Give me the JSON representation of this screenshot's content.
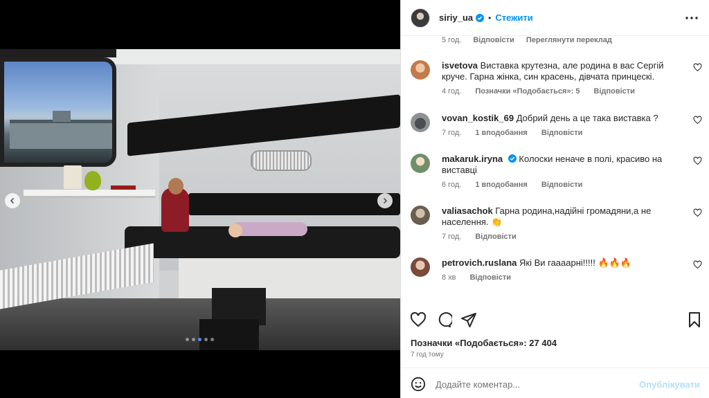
{
  "post": {
    "username": "siriy_ua",
    "separator": "•",
    "follow_label": "Стежити"
  },
  "caption_meta": {
    "time": "5 год.",
    "reply": "Відповісти",
    "translate": "Переглянути переклад"
  },
  "comments": [
    {
      "username": "isvetova",
      "text": "Виставка крутезна, але родина в вас Сергій круче. Гарна жінка, син красень, дівчата принцескі.",
      "time": "4 год.",
      "likes": "Позначки «Подобається»: 5",
      "reply": "Відповісти",
      "verified": false
    },
    {
      "username": "vovan_kostik_69",
      "text": "Добрий день а це така виставка ?",
      "time": "7 год.",
      "likes": "1 вподобання",
      "reply": "Відповісти",
      "verified": false
    },
    {
      "username": "makaruk.iryna",
      "text": "Колоски неначе в полі, красиво на виставці",
      "time": "6 год.",
      "likes": "1 вподобання",
      "reply": "Відповісти",
      "verified": true
    },
    {
      "username": "valiasachok",
      "text": "Гарна родина,надійні громадяни,а не населення. 👏",
      "time": "7 год.",
      "likes": "",
      "reply": "Відповісти",
      "verified": false
    },
    {
      "username": "petrovich.ruslana",
      "text": "Які Ви гаааарні!!!!! 🔥🔥🔥",
      "time": "8 хв",
      "likes": "",
      "reply": "Відповісти",
      "verified": false
    }
  ],
  "stats": {
    "likes": "Позначки «Подобається»: 27 404",
    "date": "7 год тому"
  },
  "composer": {
    "placeholder": "Додайте коментар...",
    "publish": "Опублікувати"
  },
  "carousel": {
    "slide_count": 5,
    "active_index": 2
  },
  "colors": {
    "accent": "#0095f6",
    "publish_disabled": "#b2dffc",
    "muted": "#737373"
  }
}
